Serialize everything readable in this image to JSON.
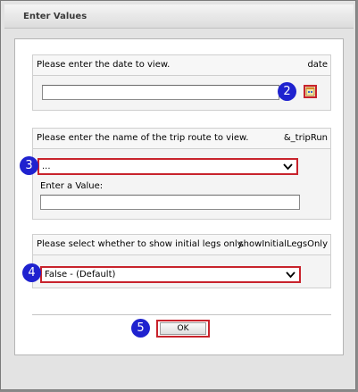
{
  "dialog": {
    "title": "Enter Values"
  },
  "date_param": {
    "prompt": "Please enter the date to view.",
    "name": "date",
    "value": "",
    "badge": "2",
    "calendar_icon": "calendar-icon"
  },
  "trip_param": {
    "prompt": "Please enter the name of the trip route to view.",
    "name": "&_tripRun",
    "selected": "...",
    "badge": "3",
    "enter_value_label": "Enter a Value:",
    "value": ""
  },
  "legs_param": {
    "prompt": "Please select whether to show initial legs only.",
    "name": "showInitialLegsOnly",
    "selected": "False - (Default)",
    "badge": "4"
  },
  "ok": {
    "label": "OK",
    "badge": "5"
  },
  "colors": {
    "highlight": "#c8232c",
    "badge": "#1f22cf"
  }
}
